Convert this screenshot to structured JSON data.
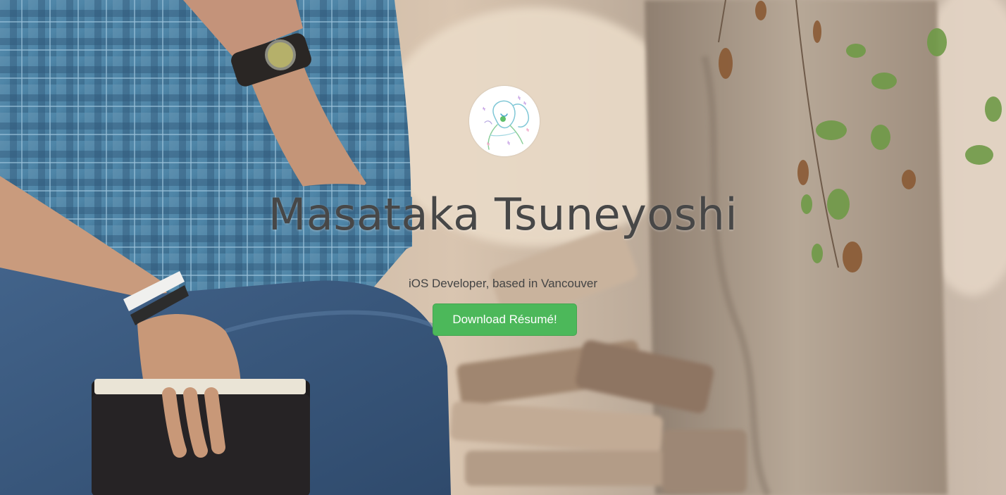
{
  "profile": {
    "avatar_icon": "sketch-portrait-avatar",
    "name": "Masataka Tsuneyoshi",
    "tagline": "iOS Developer, based in Vancouver"
  },
  "actions": {
    "download_label": "Download Résumé!"
  },
  "colors": {
    "button_bg": "#4cb85a",
    "name_text": "#474747",
    "tagline_text": "#444444"
  }
}
